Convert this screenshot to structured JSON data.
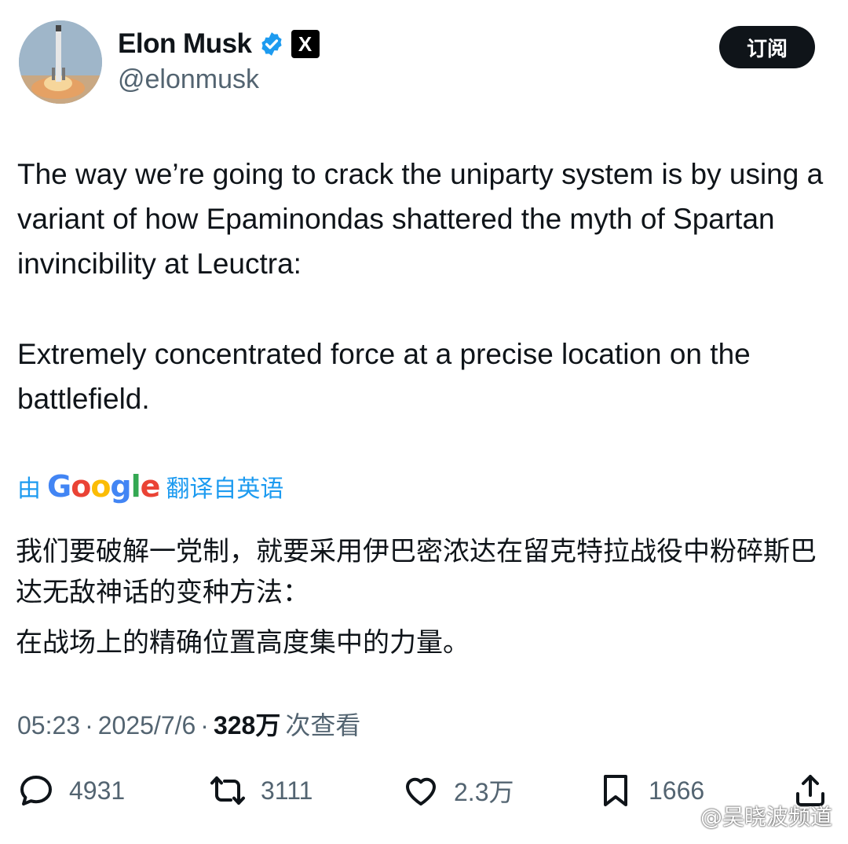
{
  "author": {
    "name": "Elon Musk",
    "handle": "@elonmusk",
    "verified": true,
    "affiliate_badge": "X"
  },
  "subscribe_label": "订阅",
  "tweet": {
    "paragraphs": [
      "The way we’re going to crack the uniparty system is by using a variant of how Epaminondas shattered the myth of Spartan invincibility at Leuctra:",
      "Extremely concentrated force at a precise location on the battlefield."
    ]
  },
  "translation": {
    "prefix": "由",
    "provider": "Google",
    "suffix": "翻译自英语",
    "paragraphs": [
      "我们要破解一党制，就要采用伊巴密浓达在留克特拉战役中粉碎斯巴达无敌神话的变种方法：",
      "在战场上的精确位置高度集中的力量。"
    ]
  },
  "meta": {
    "time": "05:23",
    "date": "2025/7/6",
    "views": "328万",
    "views_label": "次查看"
  },
  "actions": {
    "replies": "4931",
    "reposts": "3111",
    "likes": "2.3万",
    "bookmarks": "1666"
  },
  "watermark": "@吴晓波频道",
  "colors": {
    "link": "#1d9bf0",
    "secondary_text": "#536471",
    "primary_text": "#0f1419",
    "verified": "#1d9bf0"
  }
}
